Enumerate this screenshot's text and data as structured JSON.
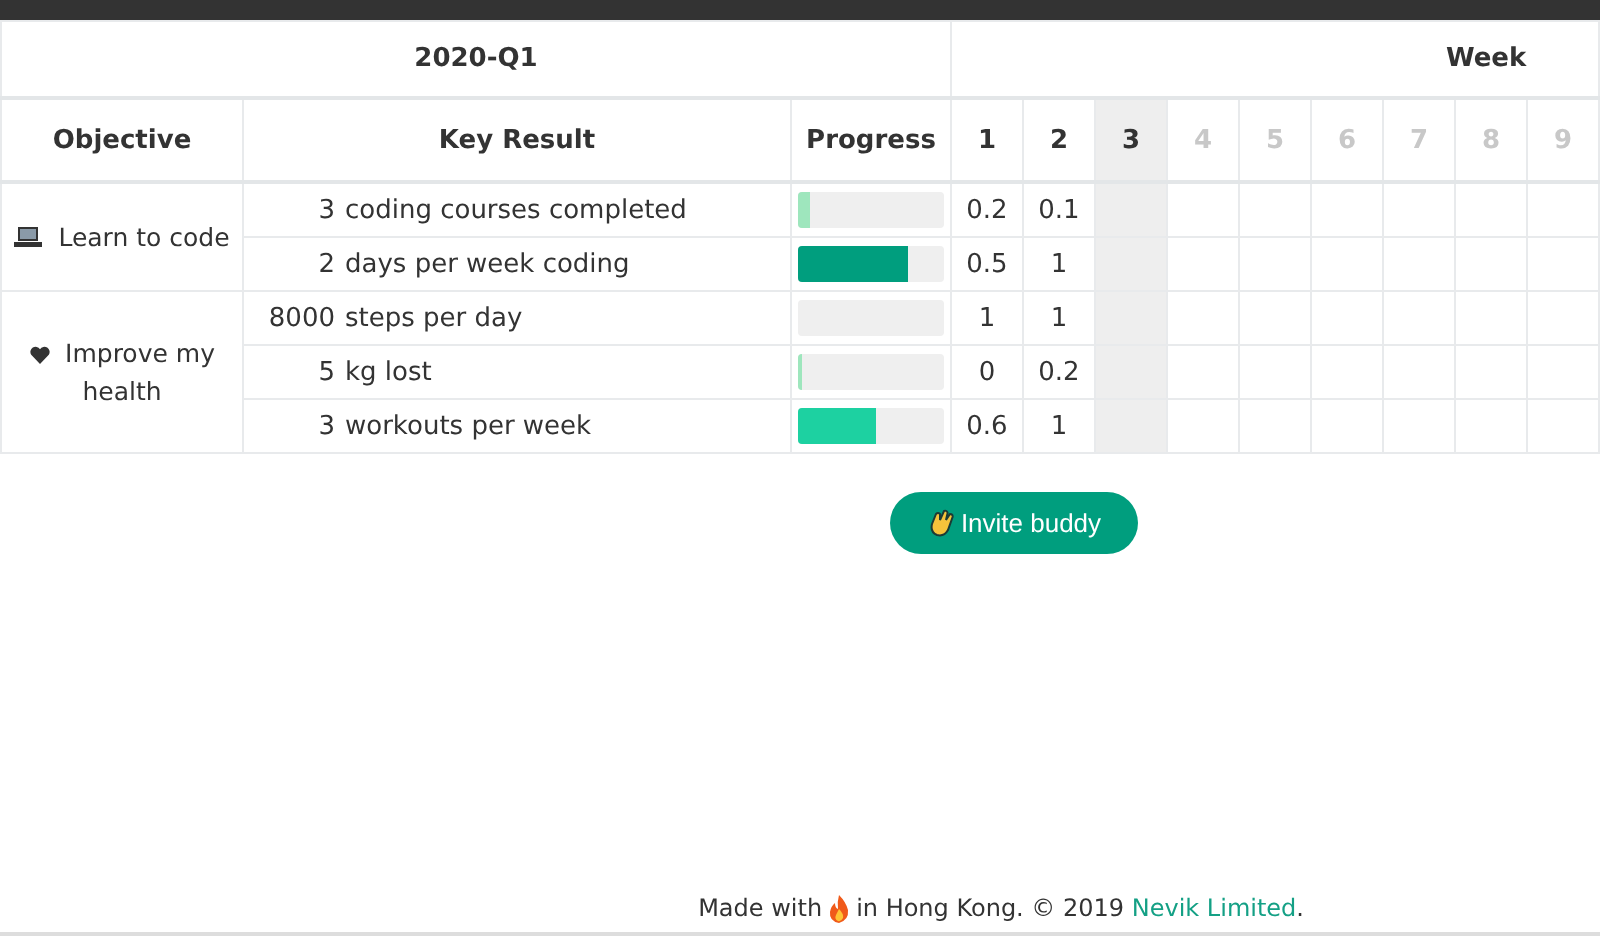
{
  "quarter": "2020-Q1",
  "week_heading": "Week",
  "columns": {
    "objective": "Objective",
    "key_result": "Key Result",
    "progress": "Progress"
  },
  "weeks": [
    {
      "label": "1",
      "kind": "past"
    },
    {
      "label": "2",
      "kind": "past"
    },
    {
      "label": "3",
      "kind": "current"
    },
    {
      "label": "4",
      "kind": "future"
    },
    {
      "label": "5",
      "kind": "future"
    },
    {
      "label": "6",
      "kind": "future"
    },
    {
      "label": "7",
      "kind": "future"
    },
    {
      "label": "8",
      "kind": "future"
    },
    {
      "label": "9",
      "kind": "future"
    }
  ],
  "objectives": [
    {
      "name": "Learn to code",
      "key_results": [
        {
          "target": "3",
          "text": "coding courses completed",
          "level": 0.08,
          "scores": [
            "0.2",
            "0.1"
          ]
        },
        {
          "target": "2",
          "text": "days per week coding",
          "level": 0.75,
          "scores": [
            "0.5",
            "1"
          ]
        }
      ]
    },
    {
      "name": "Improve my health",
      "key_results": [
        {
          "target": "8000",
          "text": "steps per day",
          "scores": [
            "1",
            "1"
          ]
        },
        {
          "target": "5",
          "text": "kg lost",
          "level": 0.03,
          "scores": [
            "0",
            "0.2"
          ]
        },
        {
          "target": "3",
          "text": "workouts per week",
          "level": 0.53,
          "scores": [
            "0.6",
            "1"
          ]
        }
      ]
    }
  ],
  "invite_button": "Invite buddy",
  "footer": {
    "prefix": "Made with",
    "middle": "in Hong Kong. © 2019",
    "link": "Nevik Limited",
    "suffix": "."
  }
}
